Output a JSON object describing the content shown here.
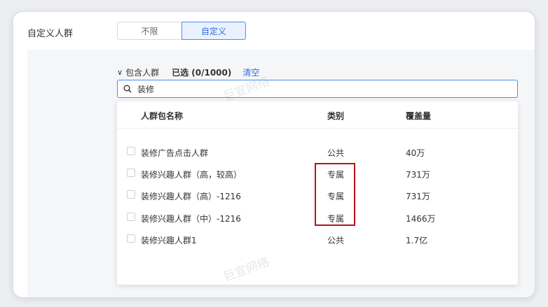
{
  "form": {
    "label": "自定义人群",
    "options": [
      "不限",
      "自定义"
    ],
    "selected": "自定义"
  },
  "filter": {
    "chevron": "chevron-down-icon",
    "include_label": "包含人群",
    "selected_count": "已选 (0/1000)",
    "clear_label": "清空"
  },
  "search": {
    "icon": "search-icon",
    "value": "装修"
  },
  "table": {
    "headers": {
      "name": "人群包名称",
      "type": "类别",
      "coverage": "覆盖量"
    },
    "rows": [
      {
        "name": "装修广告点击人群",
        "type": "公共",
        "coverage": "40万"
      },
      {
        "name": "装修兴趣人群（高，较高）",
        "type": "专属",
        "coverage": "731万"
      },
      {
        "name": "装修兴趣人群（高）-1216",
        "type": "专属",
        "coverage": "731万"
      },
      {
        "name": "装修兴趣人群（中）-1216",
        "type": "专属",
        "coverage": "1466万"
      },
      {
        "name": "装修兴趣人群1",
        "type": "公共",
        "coverage": "1.7亿"
      }
    ]
  },
  "watermark": "巨宣网络",
  "colors": {
    "accent": "#2f6fd8",
    "highlight": "#b5121b"
  }
}
